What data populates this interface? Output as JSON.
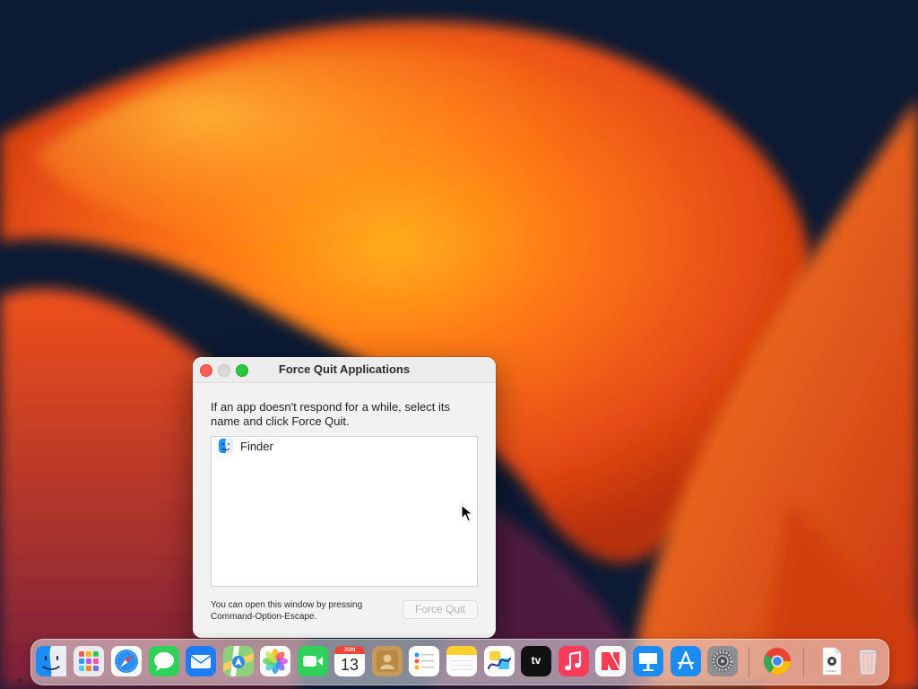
{
  "window": {
    "title": "Force Quit Applications",
    "instructions": "If an app doesn't respond for a while, select its name and click Force Quit.",
    "apps": [
      {
        "name": "Finder",
        "icon": "finder-icon"
      }
    ],
    "hint": "You can open this window by pressing Command-Option-Escape.",
    "force_quit_label": "Force Quit"
  },
  "dock": {
    "items": [
      {
        "name": "Finder",
        "icon": "finder-icon",
        "running": true
      },
      {
        "name": "Launchpad",
        "icon": "launchpad-icon"
      },
      {
        "name": "Safari",
        "icon": "safari-icon"
      },
      {
        "name": "Messages",
        "icon": "messages-icon"
      },
      {
        "name": "Mail",
        "icon": "mail-icon"
      },
      {
        "name": "Maps",
        "icon": "maps-icon"
      },
      {
        "name": "Photos",
        "icon": "photos-icon"
      },
      {
        "name": "FaceTime",
        "icon": "facetime-icon"
      },
      {
        "name": "Calendar",
        "icon": "calendar-icon",
        "month": "JUN",
        "day": "13"
      },
      {
        "name": "Contacts",
        "icon": "contacts-icon"
      },
      {
        "name": "Reminders",
        "icon": "reminders-icon"
      },
      {
        "name": "Notes",
        "icon": "notes-icon"
      },
      {
        "name": "Freeform",
        "icon": "freeform-icon"
      },
      {
        "name": "Apple TV",
        "icon": "tv-icon",
        "label": "tv"
      },
      {
        "name": "Music",
        "icon": "music-icon"
      },
      {
        "name": "News",
        "icon": "news-icon"
      },
      {
        "name": "Keynote",
        "icon": "keynote-icon"
      },
      {
        "name": "App Store",
        "icon": "app-store-icon"
      },
      {
        "name": "System Settings",
        "icon": "settings-icon"
      },
      {
        "name": "Google Chrome",
        "icon": "chrome-icon"
      },
      {
        "name": "Document",
        "icon": "document-icon",
        "label": "CONFIG"
      },
      {
        "name": "Trash",
        "icon": "trash-icon"
      }
    ]
  },
  "colors": {
    "close": "#ff5f57",
    "minimize": "#d8d8d8",
    "zoom": "#28c840",
    "wallpaper_orange": "#ff7a1a",
    "wallpaper_dark": "#0c1a33"
  }
}
